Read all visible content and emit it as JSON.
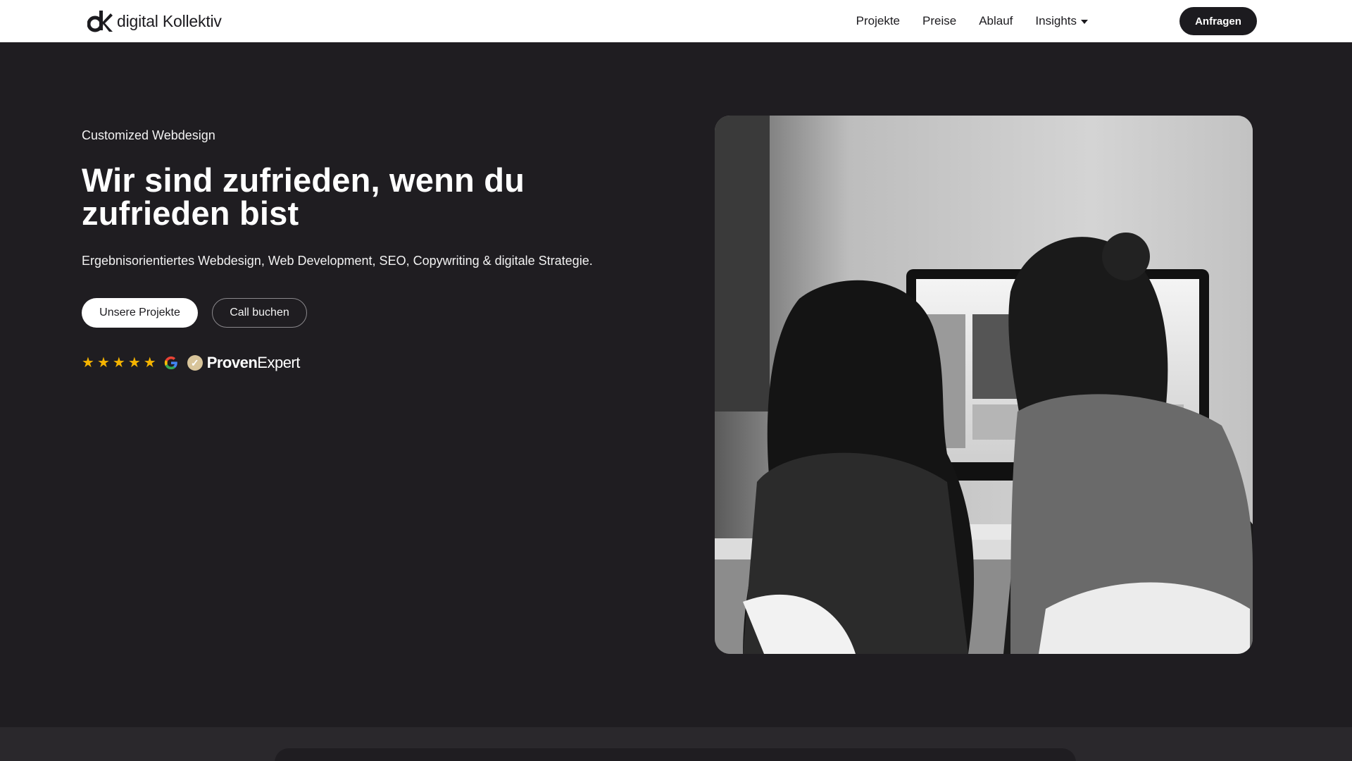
{
  "brand": {
    "name": "digital Kollektiv"
  },
  "nav": {
    "items": [
      {
        "label": "Projekte"
      },
      {
        "label": "Preise"
      },
      {
        "label": "Ablauf"
      },
      {
        "label": "Insights",
        "has_dropdown": true
      }
    ],
    "cta_label": "Anfragen"
  },
  "hero": {
    "eyebrow": "Customized Webdesign",
    "headline_line1": "Wir sind zufrieden, wenn du",
    "headline_line2": "zufrieden bist",
    "subline": "Ergebnisorientiertes Webdesign, Web Development, SEO, Copywriting & digitale Strategie.",
    "primary_button": "Unsere Projekte",
    "secondary_button": "Call buchen"
  },
  "rating": {
    "stars": 5,
    "review_platforms": [
      "google-icon",
      "proven-expert-logo"
    ],
    "proven_bold": "Proven",
    "proven_light": "Expert"
  },
  "colors": {
    "background": "#1f1d21",
    "nav_background": "#ffffff",
    "star": "#f5b400",
    "badge": "#d8c49a"
  }
}
